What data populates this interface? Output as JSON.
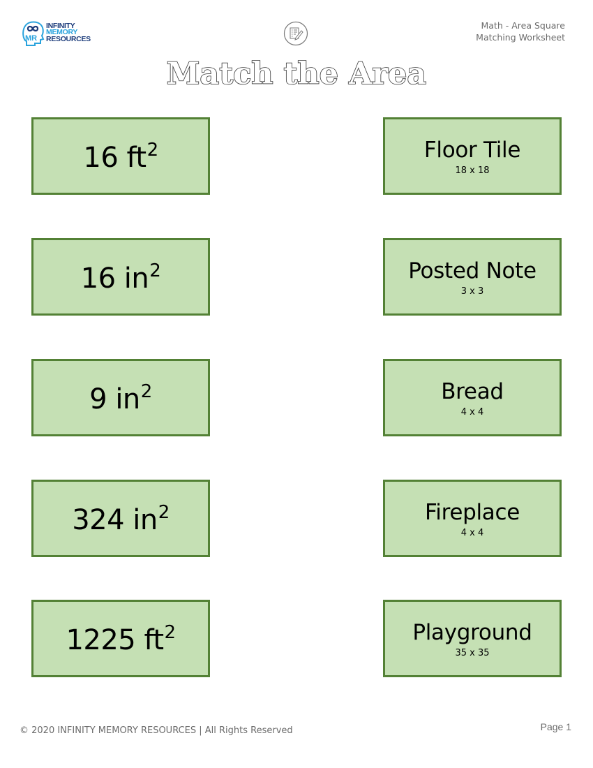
{
  "header": {
    "logo": {
      "line1": "INFINITY",
      "line2": "MEMORY",
      "line3": "RESOURCES",
      "monogram": "MR",
      "colors": {
        "navy": "#1a3a7a",
        "blue": "#29a3dd"
      }
    },
    "center_icon": "worksheet-pencil-icon",
    "meta_line1": "Math - Area Square",
    "meta_line2": "Matching Worksheet"
  },
  "title": "Match the Area",
  "colors": {
    "card_fill": "#c5e0b4",
    "card_border": "#538135",
    "meta_text": "#6b6b6b"
  },
  "areas": [
    {
      "value": "16 ft",
      "exponent": "2"
    },
    {
      "value": "16 in",
      "exponent": "2"
    },
    {
      "value": "9 in",
      "exponent": "2"
    },
    {
      "value": "324 in",
      "exponent": "2"
    },
    {
      "value": "1225 ft",
      "exponent": "2"
    }
  ],
  "items": [
    {
      "name": "Floor Tile",
      "dims": "18 x 18"
    },
    {
      "name": "Posted Note",
      "dims": "3 x 3"
    },
    {
      "name": "Bread",
      "dims": "4 x 4"
    },
    {
      "name": "Fireplace",
      "dims": "4 x 4"
    },
    {
      "name": "Playground",
      "dims": "35 x 35"
    }
  ],
  "footer": {
    "copyright": "© 2020 INFINITY MEMORY RESOURCES  |  All Rights Reserved",
    "page": "Page 1"
  }
}
